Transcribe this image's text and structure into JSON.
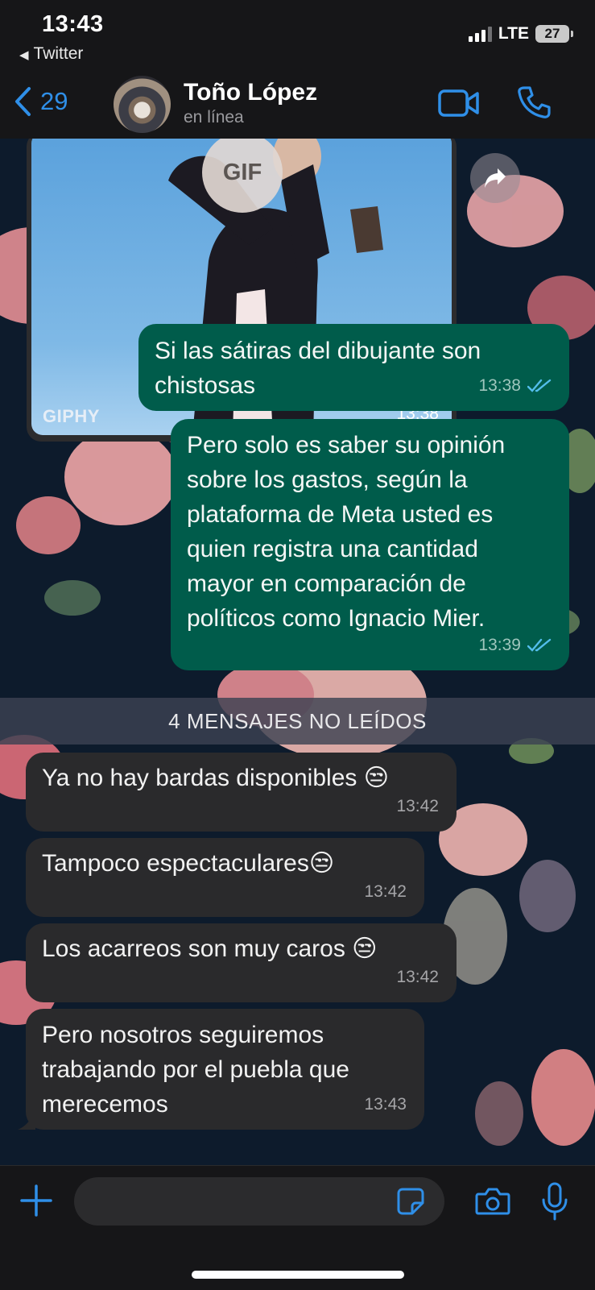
{
  "status_bar": {
    "time": "13:43",
    "back_app": "Twitter",
    "network": "LTE",
    "battery": "27"
  },
  "header": {
    "back_count": "29",
    "contact_name": "Toño López",
    "contact_status": "en línea",
    "icons": [
      "chevron-left-icon",
      "video-camera-icon",
      "phone-icon"
    ]
  },
  "gif_message": {
    "badge": "GIF",
    "source": "GIPHY",
    "time": "13:38"
  },
  "messages": [
    {
      "direction": "out",
      "text": "Si las sátiras del dibujante son chistosas",
      "time": "13:38",
      "read": true
    },
    {
      "direction": "out",
      "text": "Pero solo es saber su opinión sobre los gastos, según la plataforma de Meta usted es quien registra una cantidad mayor en comparación de políticos como Ignacio Mier.",
      "time": "13:39",
      "read": true
    },
    {
      "direction": "in",
      "text": "Ya no hay bardas disponibles 😒",
      "time": "13:42"
    },
    {
      "direction": "in",
      "text": "Tampoco espectaculares😒",
      "time": "13:42"
    },
    {
      "direction": "in",
      "text": "Los acarreos son muy caros 😒",
      "time": "13:42"
    },
    {
      "direction": "in",
      "text": "Pero nosotros seguiremos trabajando por el puebla que merecemos",
      "time": "13:43"
    }
  ],
  "unread_banner": "4 MENSAJES NO LEÍDOS",
  "composer": {
    "input_value": "",
    "icons": [
      "plus-icon",
      "sticker-icon",
      "camera-icon",
      "microphone-icon"
    ]
  },
  "colors": {
    "accent": "#2f8fe8",
    "outgoing_bubble": "#005c4b",
    "incoming_bubble": "#2a2a2c",
    "read_check": "#53bdeb"
  }
}
